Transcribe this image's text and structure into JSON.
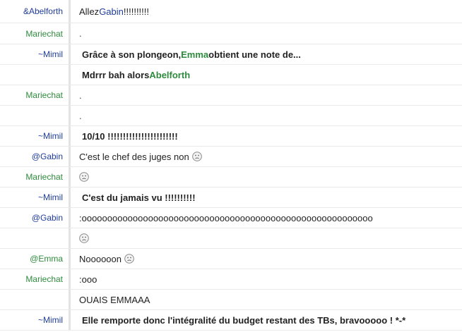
{
  "rows": [
    {
      "nick": "&Abelforth",
      "nick_color": "blue",
      "bold": false,
      "parts": [
        "Allez ",
        "Gabin",
        " !!!!!!!!!!"
      ],
      "smiley": false
    },
    {
      "nick": "Mariechat",
      "nick_color": "green",
      "bold": false,
      "parts": [
        "."
      ],
      "smiley": false
    },
    {
      "nick": "~Mimil",
      "nick_color": "blue",
      "bold": true,
      "parts": [
        "Grâce à son plongeon, ",
        "Emma",
        " obtient une note de..."
      ],
      "smiley": false
    },
    {
      "nick": "",
      "nick_color": "blue",
      "bold": true,
      "parts": [
        "Mdrrr bah alors ",
        "Abelforth",
        ""
      ],
      "smiley": false
    },
    {
      "nick": "Mariechat",
      "nick_color": "green",
      "bold": false,
      "parts": [
        "."
      ],
      "smiley": false
    },
    {
      "nick": "",
      "nick_color": "green",
      "bold": false,
      "parts": [
        "."
      ],
      "smiley": false
    },
    {
      "nick": "~Mimil",
      "nick_color": "blue",
      "bold": true,
      "parts": [
        "10/10 !!!!!!!!!!!!!!!!!!!!!!!"
      ],
      "smiley": false
    },
    {
      "nick": "@Gabin",
      "nick_color": "blue",
      "bold": false,
      "parts": [
        "C'est le chef des juges non"
      ],
      "smiley": true
    },
    {
      "nick": "Mariechat",
      "nick_color": "green",
      "bold": false,
      "parts": [
        ""
      ],
      "smiley": true
    },
    {
      "nick": "~Mimil",
      "nick_color": "blue",
      "bold": true,
      "parts": [
        "C'est du jamais vu !!!!!!!!!!"
      ],
      "smiley": false
    },
    {
      "nick": "@Gabin",
      "nick_color": "blue",
      "bold": false,
      "parts": [
        ":ooooooooooooooooooooooooooooooooooooooooooooooooooooooooo"
      ],
      "smiley": false
    },
    {
      "nick": "",
      "nick_color": "blue",
      "bold": false,
      "parts": [
        ""
      ],
      "smiley": true
    },
    {
      "nick": "@Emma",
      "nick_color": "green",
      "bold": false,
      "parts": [
        "Noooooon"
      ],
      "smiley": true
    },
    {
      "nick": "Mariechat",
      "nick_color": "green",
      "bold": false,
      "parts": [
        ":ooo"
      ],
      "smiley": false
    },
    {
      "nick": "",
      "nick_color": "green",
      "bold": false,
      "parts": [
        "OUAIS EMMAAA"
      ],
      "smiley": false
    },
    {
      "nick": "~Mimil",
      "nick_color": "blue",
      "bold": true,
      "parts": [
        "Elle remporte donc l'intégralité du budget restant des TBs, bravooooo ! *-*"
      ],
      "smiley": false
    }
  ],
  "colors": {
    "nick_green": "#2e8b3d",
    "nick_blue": "#1f3c9a",
    "highlight_green": "#2e8b3d",
    "highlight_blue": "#1f3c9a"
  }
}
